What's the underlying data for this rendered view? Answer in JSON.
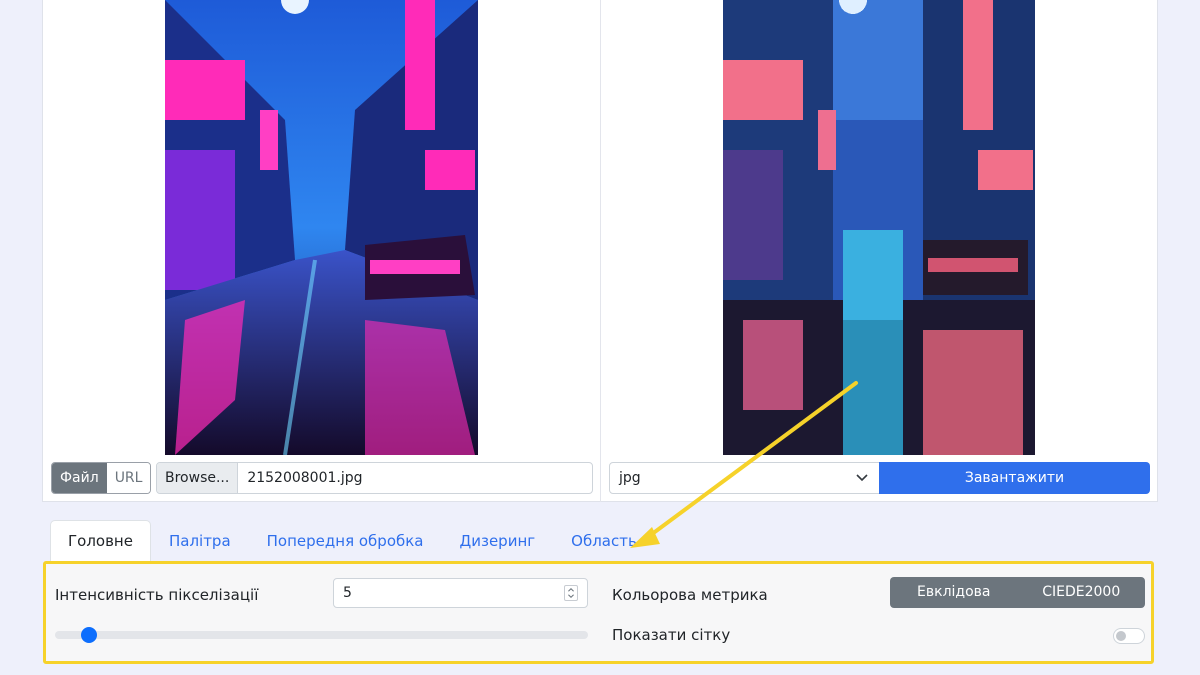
{
  "source": {
    "mode_options": [
      "Файл",
      "URL"
    ],
    "active_mode": "Файл",
    "browse_label": "Browse...",
    "file_name": "2152008001.jpg"
  },
  "output": {
    "format_value": "jpg",
    "download_label": "Завантажити"
  },
  "tabs": [
    {
      "label": "Головне",
      "active": true
    },
    {
      "label": "Палітра",
      "active": false
    },
    {
      "label": "Попередня обробка",
      "active": false
    },
    {
      "label": "Дизеринг",
      "active": false
    },
    {
      "label": "Область",
      "active": false
    }
  ],
  "settings": {
    "pixel_intensity_label": "Інтенсивність пікселізації",
    "pixel_intensity_value": "5",
    "pixel_intensity_slider_fraction": 0.05,
    "color_metric_label": "Кольорова метрика",
    "color_metric_options": [
      "Евклідова",
      "CIEDE2000"
    ],
    "show_grid_label": "Показати сітку",
    "show_grid_on": false
  },
  "colors": {
    "accent": "#2f6fec",
    "highlight": "#f6d22a",
    "neon_pink": "#ff2bb8",
    "neon_blue": "#2a6cf0"
  }
}
